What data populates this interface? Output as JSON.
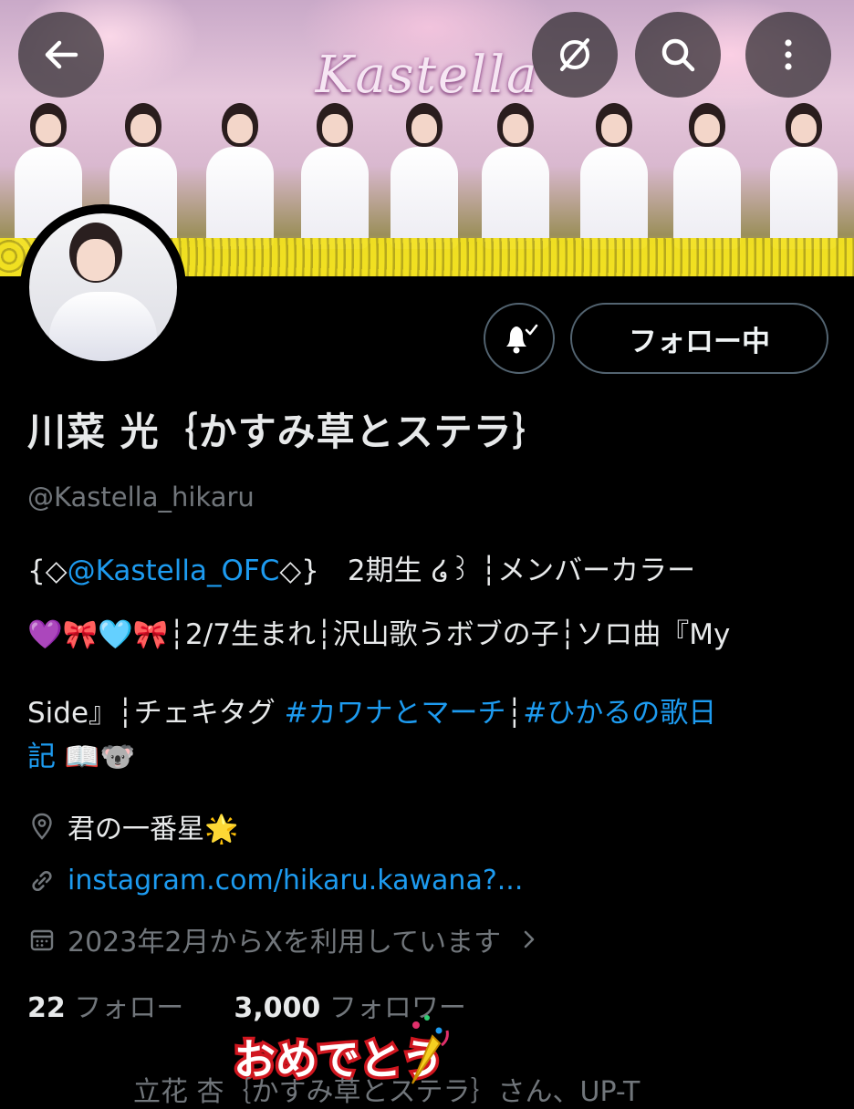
{
  "banner": {
    "title": "Kastella"
  },
  "profile": {
    "follow_button": "フォロー中",
    "display_name": "川菜 光｛かすみ草とステラ｝",
    "handle": "@Kastella_hikaru",
    "bio": {
      "line1_prefix": "{◇",
      "line1_mention": "@Kastella_OFC",
      "line1_suffix": "◇}　2期生 ໒꒱ ┆メンバーカラー",
      "line2": "💜🎀🩵🎀┆2/7生まれ┆沢山歌うボブの子┆ソロ曲『My",
      "line3_prefix": "Side』┆チェキタグ ",
      "line3_tag1": "#カワナとマーチ",
      "line3_sep": "┆",
      "line3_tag2": "#ひかるの歌日",
      "line4_tag_end": "記",
      "line4_emoji": " 📖🐨"
    },
    "location": "君の一番星🌟",
    "website": "instagram.com/hikaru.kawana?...",
    "joined": "2023年2月からXを利用しています",
    "following_count": "22",
    "following_label": "フォロー",
    "followers_count": "3,000",
    "followers_label": "フォロワー"
  },
  "sticker_text": "おめでとう",
  "footer": "立花 杏｛かすみ草とステラ｝さん、UP-T"
}
